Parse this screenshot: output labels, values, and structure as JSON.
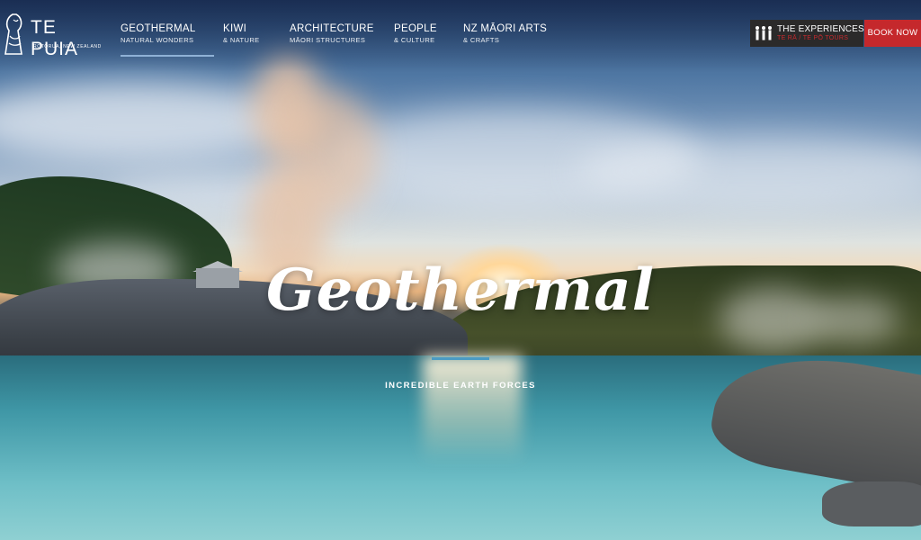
{
  "brand": {
    "name": "TE PUIA",
    "tagline": "ROTORUA, NEW ZEALAND"
  },
  "nav": [
    {
      "title": "GEOTHERMAL",
      "sub": "NATURAL WONDERS"
    },
    {
      "title": "KIWI",
      "sub": "& NATURE"
    },
    {
      "title": "ARCHITECTURE",
      "sub": "MĀORI STRUCTURES"
    },
    {
      "title": "PEOPLE",
      "sub": "& CULTURE"
    },
    {
      "title": "NZ MĀORI ARTS",
      "sub": "& CRAFTS"
    }
  ],
  "experiences": {
    "title": "THE EXPERIENCES",
    "sub": "TE RĀ / TE PŌ TOURS"
  },
  "book_now": "BOOK NOW",
  "hero": {
    "title": "Geothermal",
    "subtitle": "INCREDIBLE EARTH FORCES"
  },
  "colors": {
    "book_button": "#c5282c",
    "experiences_bg": "#2b2a2a",
    "accent_rule": "#4b9bc4"
  }
}
